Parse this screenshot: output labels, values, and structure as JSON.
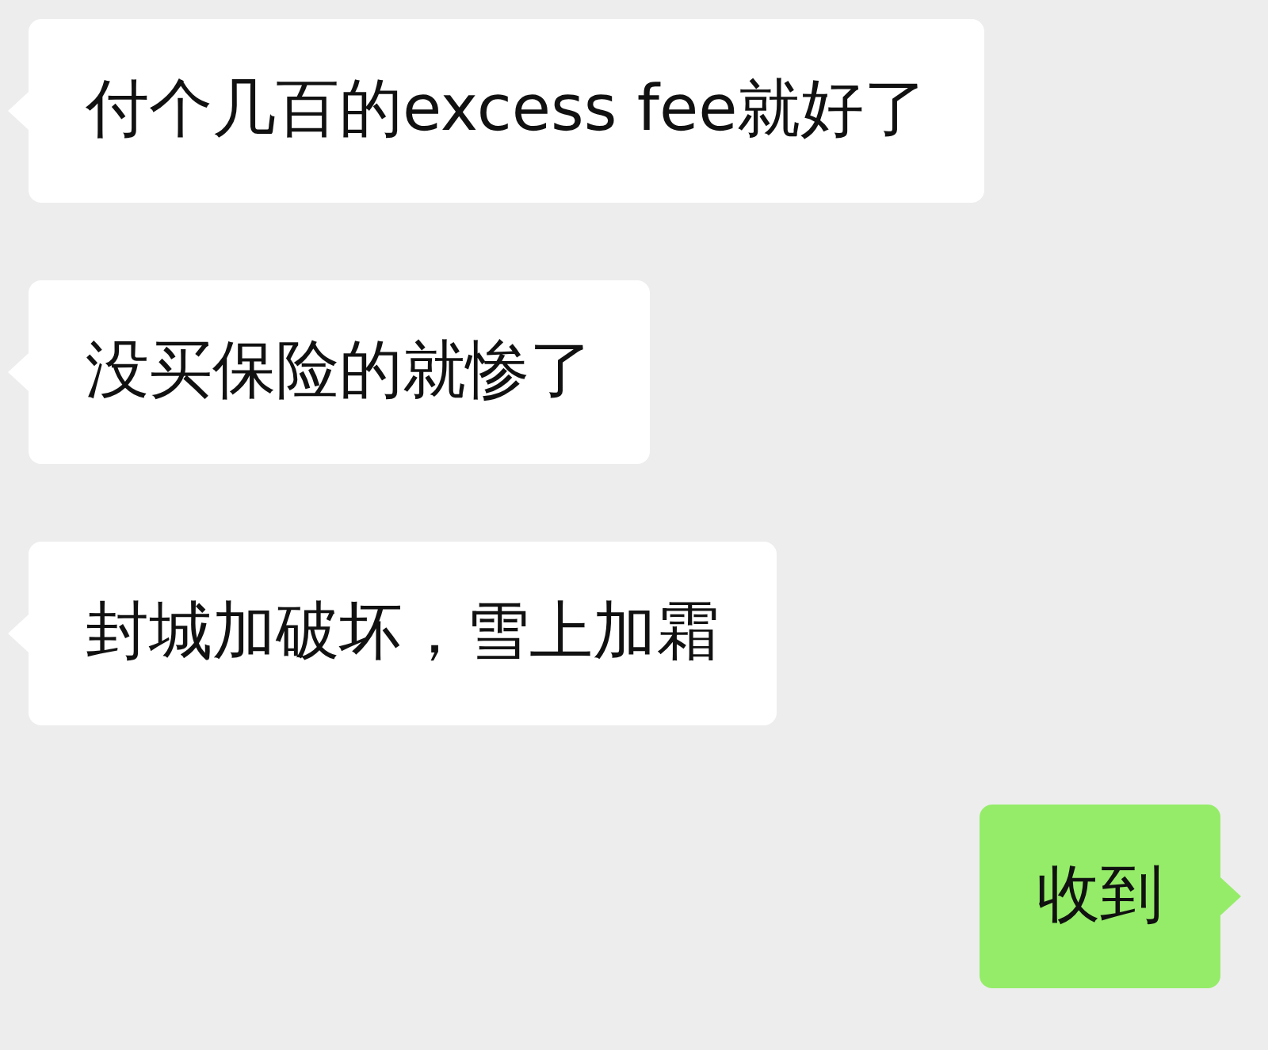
{
  "messages": [
    {
      "kind": "received",
      "text": "付个几百的excess fee就好了"
    },
    {
      "kind": "received",
      "text": "没买保险的就惨了"
    },
    {
      "kind": "received",
      "text": "封城加破坏，雪上加霜"
    },
    {
      "kind": "sent",
      "text": "收到"
    }
  ]
}
